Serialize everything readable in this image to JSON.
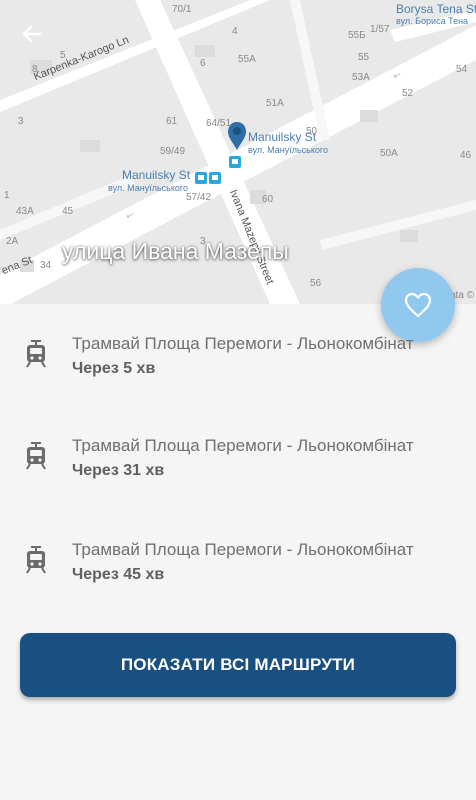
{
  "header": {
    "street_title": "улица Ивана Мазепы"
  },
  "map": {
    "labels": {
      "stop1_en": "Manuilsky St",
      "stop1_ua": "вул. Мануїльського",
      "stop2_en": "Manuilsky St",
      "stop2_ua": "вул. Мануїльського",
      "borysa_en": "Borysa Tena St",
      "borysa_ua": "вул. Бориса Тена",
      "karpenka": "Karpenka-Karogo Ln",
      "ivana": "Ivana Mazepy Street",
      "lena": "ena St",
      "attribution": "ata ©"
    },
    "house_numbers": [
      "70/1",
      "4",
      "1/57",
      "55Б",
      "5",
      "6",
      "8",
      "55А",
      "55",
      "53А",
      "52",
      "54",
      "3",
      "51А",
      "61",
      "64/51",
      "59/49",
      "50",
      "50А",
      "43А",
      "45",
      "57/42",
      "60",
      "2А",
      "34",
      "56",
      "3",
      "1",
      "46"
    ]
  },
  "routes": [
    {
      "title": "Трамвай Площа Перемоги - Льонокомбінат",
      "eta": "Через 5 хв"
    },
    {
      "title": "Трамвай Площа Перемоги - Льонокомбінат",
      "eta": "Через 31 хв"
    },
    {
      "title": "Трамвай Площа Перемоги - Льонокомбінат",
      "eta": "Через 45 хв"
    }
  ],
  "actions": {
    "show_all_routes": "ПОКАЗАТИ ВСІ МАРШРУТИ"
  },
  "icons": {
    "back": "arrow-left-icon",
    "favorite": "heart-icon",
    "tram": "tram-icon"
  },
  "colors": {
    "primary_button": "#1a4f82",
    "fab": "#90c8f0",
    "map_bg": "#e8e8e8"
  }
}
